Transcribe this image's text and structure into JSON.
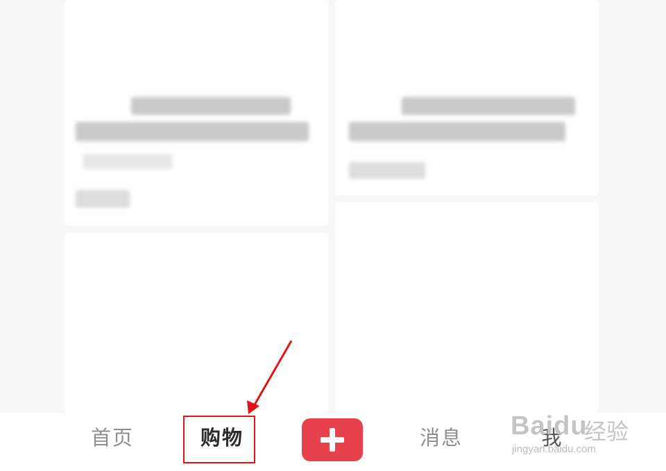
{
  "tabbar": {
    "home_label": "首页",
    "shop_label": "购物",
    "add_icon": "plus-icon",
    "messages_label": "消息",
    "me_label": "我"
  },
  "colors": {
    "accent": "#e8414e",
    "highlight": "#e01414",
    "active_text": "#2b2b2b",
    "inactive_text": "#8e8e8e"
  },
  "watermark": {
    "logo": "Baidu",
    "cn": "经验",
    "url": "jingyan.baidu.com"
  }
}
